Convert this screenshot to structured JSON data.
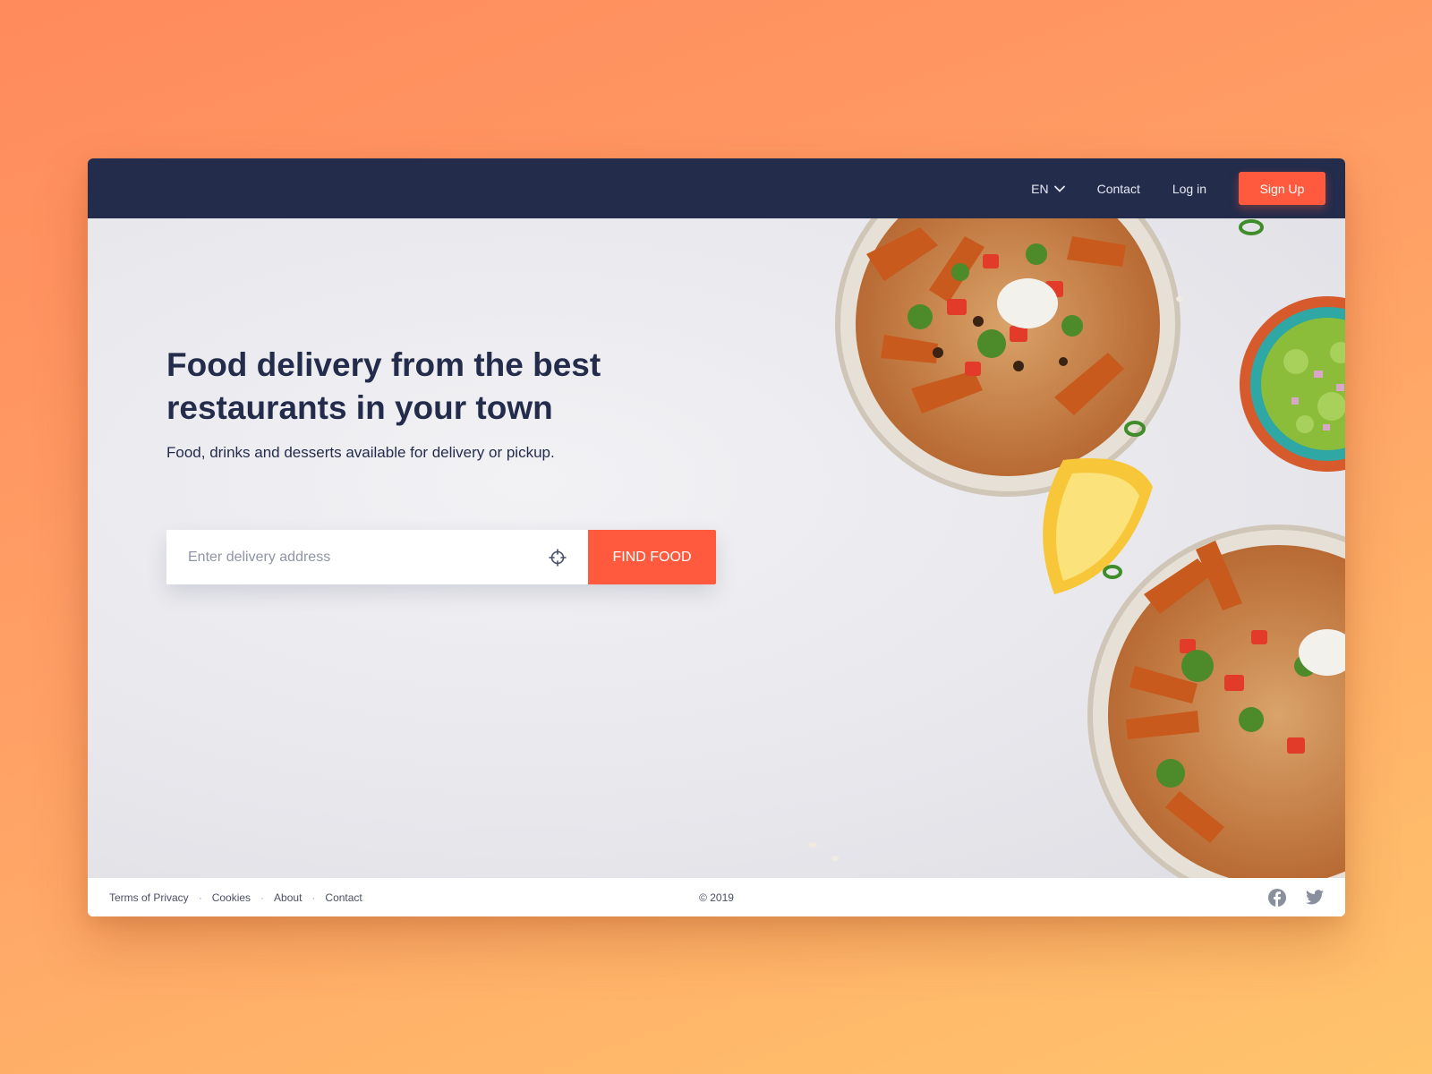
{
  "nav": {
    "language": "EN",
    "contact_label": "Contact",
    "login_label": "Log in",
    "signup_label": "Sign Up"
  },
  "hero": {
    "title": "Food delivery from the best restaurants in your town",
    "subtitle": "Food, drinks and desserts available for delivery or pickup.",
    "search": {
      "placeholder": "Enter delivery address",
      "value": "",
      "button_label": "FIND FOOD",
      "locate_icon": "crosshair-icon"
    }
  },
  "footer": {
    "links": [
      "Terms of Privacy",
      "Cookies",
      "About",
      "Contact"
    ],
    "separator": "·",
    "copyright": "© 2019",
    "social_icons": [
      "facebook-icon",
      "twitter-icon"
    ]
  },
  "colors": {
    "navbar": "#232c4b",
    "accent": "#ff5a3d",
    "text_dark": "#232c4b",
    "hero_background": "#e9e9ee"
  }
}
